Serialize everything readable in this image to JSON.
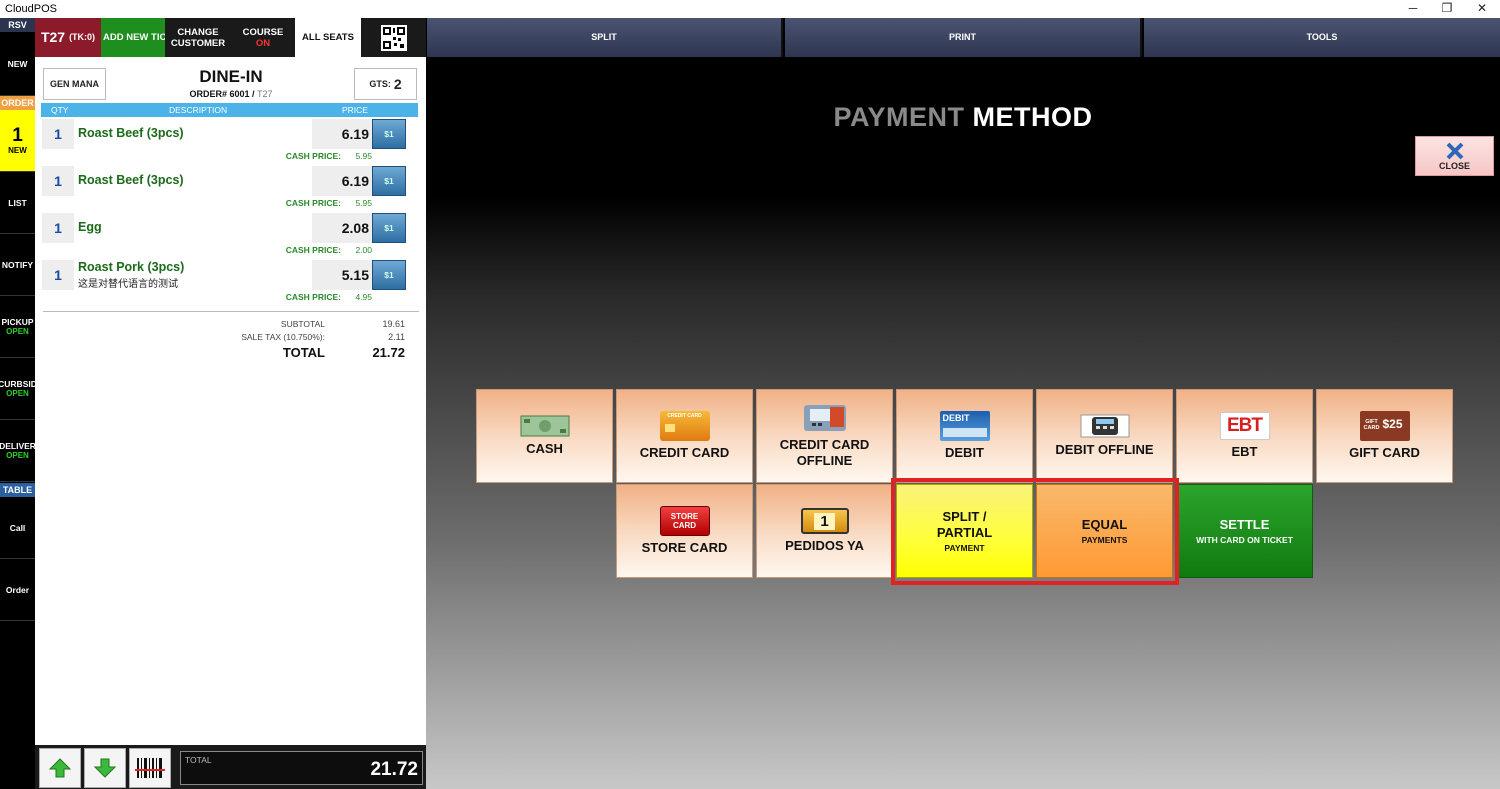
{
  "window": {
    "title": "CloudPOS",
    "min": "─",
    "max": "❐",
    "close": "✕"
  },
  "leftnav": {
    "rsv": "RSV",
    "new": "NEW",
    "order_hdr": "ORDER",
    "order_count": "1",
    "order_new": "NEW",
    "list": "LIST",
    "notify": "NOTIFY",
    "pickup": "PICKUP",
    "pickup_status": "OPEN",
    "curbside": "CURBSID",
    "curbside_status": "OPEN",
    "delivery": "DELIVER",
    "delivery_status": "OPEN",
    "table_hdr": "TABLE",
    "call": "Call",
    "order": "Order"
  },
  "topbar": {
    "table": "T27",
    "ticket": "(TK:0)",
    "add_new_ticket": "ADD NEW TIC",
    "change_customer_1": "CHANGE",
    "change_customer_2": "CUSTOMER",
    "course": "COURSE",
    "course_status": "ON",
    "all_seats": "ALL SEATS",
    "split": "SPLIT",
    "print": "PRINT",
    "tools": "TOOLS"
  },
  "order": {
    "gen_mana": "GEN MANA",
    "type": "DINE-IN",
    "order_label": "ORDER# 6001 / ",
    "table": "T27",
    "gts_label": "GTS:",
    "gts": "2",
    "col_qty": "QTY",
    "col_desc": "DESCRIPTION",
    "col_price": "PRICE",
    "items": [
      {
        "qty": "1",
        "name": "Roast Beef (3pcs)",
        "alt": "",
        "price": "6.19",
        "badge": "$1",
        "cash_label": "CASH PRICE:",
        "cash_price": "5.95"
      },
      {
        "qty": "1",
        "name": "Roast Beef (3pcs)",
        "alt": "",
        "price": "6.19",
        "badge": "$1",
        "cash_label": "CASH PRICE:",
        "cash_price": "5.95"
      },
      {
        "qty": "1",
        "name": "Egg",
        "alt": "",
        "price": "2.08",
        "badge": "$1",
        "cash_label": "CASH PRICE:",
        "cash_price": "2.00"
      },
      {
        "qty": "1",
        "name": "Roast Pork (3pcs)",
        "alt": "这是对替代语言的测试",
        "price": "5.15",
        "badge": "$1",
        "cash_label": "CASH PRICE:",
        "cash_price": "4.95"
      }
    ],
    "subtotal_label": "SUBTOTAL",
    "subtotal": "19.61",
    "tax_label": "SALE TAX (10.750%):",
    "tax": "2.11",
    "total_label": "TOTAL",
    "total": "21.72"
  },
  "bottom": {
    "total_label": "TOTAL",
    "total": "21.72"
  },
  "payment": {
    "title_a": "PAYMENT",
    "title_b": " METHOD",
    "close": "CLOSE",
    "cash": "CASH",
    "credit_card": "CREDIT CARD",
    "credit_card_offline_1": "CREDIT CARD",
    "credit_card_offline_2": "OFFLINE",
    "debit": "DEBIT",
    "debit_offline": "DEBIT OFFLINE",
    "ebt": "EBT",
    "gift_card": "GIFT CARD",
    "store_card": "STORE CARD",
    "pedidos_ya": "PEDIDOS YA",
    "split_1": "SPLIT /",
    "split_2": "PARTIAL",
    "split_sub": "PAYMENT",
    "equal": "EQUAL",
    "equal_sub": "PAYMENTS",
    "settle": "SETTLE",
    "settle_sub": "WITH CARD ON TICKET",
    "icon_text": {
      "credit_card_logo": "CREDIT CARD",
      "debit_logo": "DEBIT",
      "ebt_logo": "EBT",
      "gift_logo": "GIFT CARD",
      "gift_value": "$25",
      "store_logo_1": "STORE",
      "store_logo_2": "CARD",
      "pedidos_logo": "1"
    }
  },
  "colors": {
    "accent_blue": "#4bb3e8",
    "green": "#1b6b1b",
    "highlight": "#e02222"
  }
}
